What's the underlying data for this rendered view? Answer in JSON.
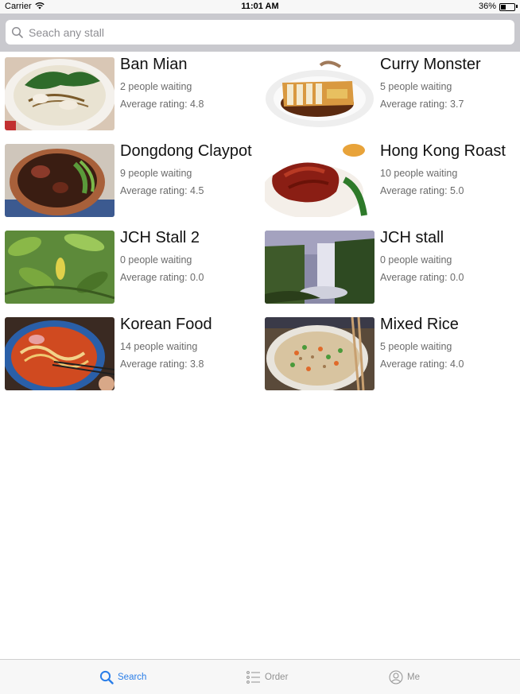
{
  "status_bar": {
    "carrier": "Carrier",
    "time": "11:01 AM",
    "battery": "36%",
    "battery_level": 0.36
  },
  "search": {
    "placeholder": "Seach any stall",
    "value": ""
  },
  "stalls": [
    {
      "name": "Ban Mian",
      "waiting": "2 people waiting",
      "rating": "Average rating: 4.8",
      "image": "noodle-soup"
    },
    {
      "name": "Curry Monster",
      "waiting": "5 people waiting",
      "rating": "Average rating: 3.7",
      "image": "katsu-curry"
    },
    {
      "name": "Dongdong Claypot",
      "waiting": "9 people waiting",
      "rating": "Average rating: 4.5",
      "image": "claypot"
    },
    {
      "name": "Hong Kong Roast",
      "waiting": "10 people waiting",
      "rating": "Average rating: 5.0",
      "image": "roast-duck"
    },
    {
      "name": "JCH Stall 2",
      "waiting": "0 people waiting",
      "rating": "Average rating: 0.0",
      "image": "leaves"
    },
    {
      "name": "JCH stall",
      "waiting": "0 people waiting",
      "rating": "Average rating: 0.0",
      "image": "waterfall"
    },
    {
      "name": "Korean Food",
      "waiting": "14 people waiting",
      "rating": "Average rating: 3.8",
      "image": "korean-stew"
    },
    {
      "name": "Mixed Rice",
      "waiting": "5 people waiting",
      "rating": "Average rating: 4.0",
      "image": "fried-rice"
    }
  ],
  "tab_bar": {
    "tabs": [
      {
        "label": "Search",
        "icon": "search-icon",
        "active": true
      },
      {
        "label": "Order",
        "icon": "list-icon",
        "active": false
      },
      {
        "label": "Me",
        "icon": "person-icon",
        "active": false
      }
    ],
    "active_color": "#2a7ee8",
    "inactive_color": "#929292"
  }
}
